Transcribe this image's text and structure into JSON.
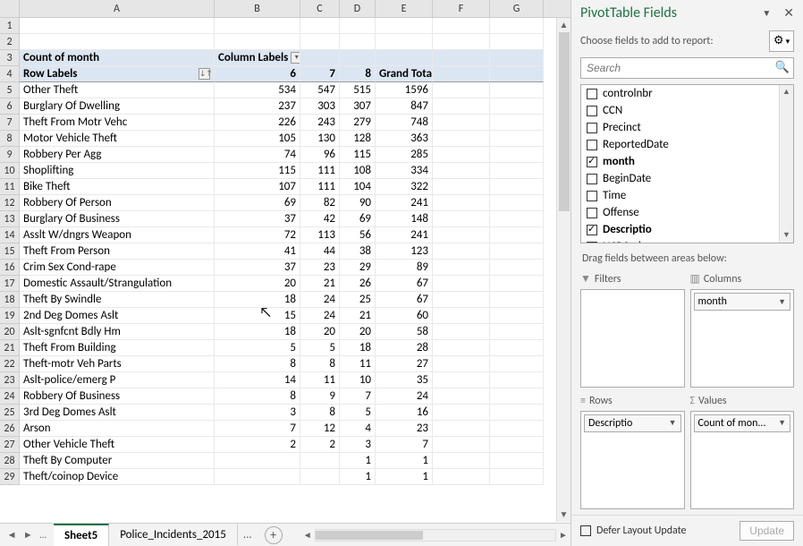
{
  "columns": [
    "A",
    "B",
    "C",
    "D",
    "E",
    "F",
    "G"
  ],
  "header2": {
    "A": "Count of month",
    "B": "Column Labels"
  },
  "header3": {
    "A": "Row Labels",
    "B": "6",
    "C": "7",
    "D": "8",
    "E": "Grand Total"
  },
  "rows": [
    {
      "n": 5,
      "a": "Other Theft",
      "b": "534",
      "c": "547",
      "d": "515",
      "e": "1596"
    },
    {
      "n": 6,
      "a": "Burglary Of Dwelling",
      "b": "237",
      "c": "303",
      "d": "307",
      "e": "847"
    },
    {
      "n": 7,
      "a": "Theft From Motr Vehc",
      "b": "226",
      "c": "243",
      "d": "279",
      "e": "748"
    },
    {
      "n": 8,
      "a": "Motor Vehicle Theft",
      "b": "105",
      "c": "130",
      "d": "128",
      "e": "363"
    },
    {
      "n": 9,
      "a": "Robbery Per Agg",
      "b": "74",
      "c": "96",
      "d": "115",
      "e": "285"
    },
    {
      "n": 10,
      "a": "Shoplifting",
      "b": "115",
      "c": "111",
      "d": "108",
      "e": "334"
    },
    {
      "n": 11,
      "a": "Bike Theft",
      "b": "107",
      "c": "111",
      "d": "104",
      "e": "322"
    },
    {
      "n": 12,
      "a": "Robbery Of Person",
      "b": "69",
      "c": "82",
      "d": "90",
      "e": "241"
    },
    {
      "n": 13,
      "a": "Burglary Of Business",
      "b": "37",
      "c": "42",
      "d": "69",
      "e": "148"
    },
    {
      "n": 14,
      "a": "Asslt W/dngrs Weapon",
      "b": "72",
      "c": "113",
      "d": "56",
      "e": "241"
    },
    {
      "n": 15,
      "a": "Theft From Person",
      "b": "41",
      "c": "44",
      "d": "38",
      "e": "123"
    },
    {
      "n": 16,
      "a": "Crim Sex Cond-rape",
      "b": "37",
      "c": "23",
      "d": "29",
      "e": "89"
    },
    {
      "n": 17,
      "a": "Domestic Assault/Strangulation",
      "b": "20",
      "c": "21",
      "d": "26",
      "e": "67"
    },
    {
      "n": 18,
      "a": "Theft By Swindle",
      "b": "18",
      "c": "24",
      "d": "25",
      "e": "67"
    },
    {
      "n": 19,
      "a": "2nd Deg Domes Aslt",
      "b": "15",
      "c": "24",
      "d": "21",
      "e": "60"
    },
    {
      "n": 20,
      "a": "Aslt-sgnfcnt Bdly Hm",
      "b": "18",
      "c": "20",
      "d": "20",
      "e": "58"
    },
    {
      "n": 21,
      "a": "Theft From Building",
      "b": "5",
      "c": "5",
      "d": "18",
      "e": "28"
    },
    {
      "n": 22,
      "a": "Theft-motr Veh Parts",
      "b": "8",
      "c": "8",
      "d": "11",
      "e": "27"
    },
    {
      "n": 23,
      "a": "Aslt-police/emerg P",
      "b": "14",
      "c": "11",
      "d": "10",
      "e": "35"
    },
    {
      "n": 24,
      "a": "Robbery Of Business",
      "b": "8",
      "c": "9",
      "d": "7",
      "e": "24"
    },
    {
      "n": 25,
      "a": "3rd Deg Domes Aslt",
      "b": "3",
      "c": "8",
      "d": "5",
      "e": "16"
    },
    {
      "n": 26,
      "a": "Arson",
      "b": "7",
      "c": "12",
      "d": "4",
      "e": "23"
    },
    {
      "n": 27,
      "a": "Other Vehicle Theft",
      "b": "2",
      "c": "2",
      "d": "3",
      "e": "7"
    },
    {
      "n": 28,
      "a": "Theft By Computer",
      "b": "",
      "c": "",
      "d": "1",
      "e": "1"
    },
    {
      "n": 29,
      "a": "Theft/coinop Device",
      "b": "",
      "c": "",
      "d": "1",
      "e": "1"
    }
  ],
  "sheets": {
    "active": "Sheet5",
    "other": "Police_Incidents_2015",
    "ellipsis": "..."
  },
  "pane": {
    "title": "PivotTable Fields",
    "subtitle": "Choose fields to add to report:",
    "search_ph": "Search",
    "fields": [
      {
        "name": "controlnbr",
        "checked": false
      },
      {
        "name": "CCN",
        "checked": false
      },
      {
        "name": "Precinct",
        "checked": false
      },
      {
        "name": "ReportedDate",
        "checked": false
      },
      {
        "name": "month",
        "checked": true
      },
      {
        "name": "BeginDate",
        "checked": false
      },
      {
        "name": "Time",
        "checked": false
      },
      {
        "name": "Offense",
        "checked": false
      },
      {
        "name": "Descriptio",
        "checked": true
      },
      {
        "name": "UCRCode",
        "checked": false
      }
    ],
    "dragmsg": "Drag fields between areas below:",
    "areas": {
      "filters": "Filters",
      "columns": "Columns",
      "rows": "Rows",
      "values": "Values",
      "columns_chip": "month",
      "rows_chip": "Descriptio",
      "values_chip": "Count of mon..."
    },
    "footer": {
      "defer": "Defer Layout Update",
      "update": "Update"
    }
  }
}
